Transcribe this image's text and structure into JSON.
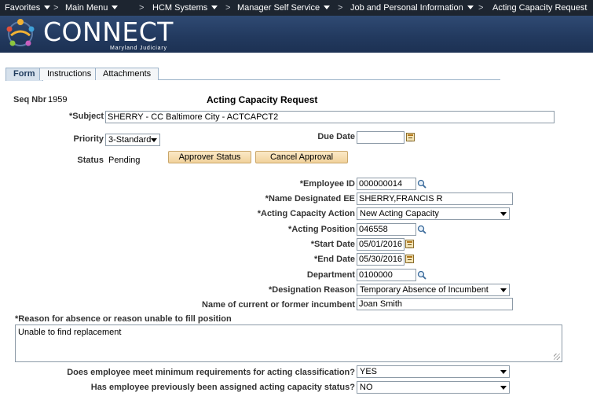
{
  "nav": {
    "items": [
      {
        "label": "Favorites"
      },
      {
        "label": "Main Menu"
      },
      {
        "label": "HCM Systems"
      },
      {
        "label": "Manager Self Service"
      },
      {
        "label": "Job and Personal Information"
      },
      {
        "label": "Acting Capacity Request"
      }
    ],
    "separator": ">"
  },
  "banner": {
    "logo_text": "CONNECT",
    "logo_sub": "Maryland Judiciary"
  },
  "tabs": [
    {
      "label": "Form",
      "active": true
    },
    {
      "label": "Instructions",
      "active": false
    },
    {
      "label": "Attachments",
      "active": false
    }
  ],
  "form": {
    "seq_label": "Seq Nbr",
    "seq_value": "1959",
    "page_title": "Acting Capacity Request",
    "subject_label": "*Subject",
    "subject_value": "SHERRY - CC Baltimore City - ACTCAPCT2",
    "priority_label": "Priority",
    "priority_value": "3-Standard",
    "due_date_label": "Due Date",
    "due_date_value": "",
    "status_label": "Status",
    "status_value": "Pending",
    "approver_status_button": "Approver Status",
    "cancel_approval_button": "Cancel Approval",
    "employee_id_label": "*Employee ID",
    "employee_id_value": "000000014",
    "name_designated_label": "*Name Designated EE",
    "name_designated_value": "SHERRY,FRANCIS R",
    "acting_action_label": "*Acting Capacity Action",
    "acting_action_value": "New Acting Capacity",
    "acting_position_label": "*Acting Position",
    "acting_position_value": "046558",
    "start_date_label": "*Start Date",
    "start_date_value": "05/01/2016",
    "end_date_label": "*End Date",
    "end_date_value": "05/30/2016",
    "department_label": "Department",
    "department_value": "0100000",
    "designation_reason_label": "*Designation Reason",
    "designation_reason_value": "Temporary Absence of Incumbent",
    "incumbent_label": "Name of current or former incumbent",
    "incumbent_value": "Joan Smith",
    "reason_absence_label": "*Reason for absence or reason unable to fill position",
    "reason_absence_value": "Unable to find replacement",
    "min_req_label": "Does employee meet minimum requirements for acting classification?",
    "min_req_value": "YES",
    "prev_assigned_label": "Has employee previously been assigned acting capacity status?",
    "prev_assigned_value": "NO"
  },
  "colors": {
    "nav_bg": "#1d2530",
    "banner_bg": "#22395e",
    "button_bg": "#f1d29b",
    "tab_active_bg": "#d6e1ec"
  }
}
